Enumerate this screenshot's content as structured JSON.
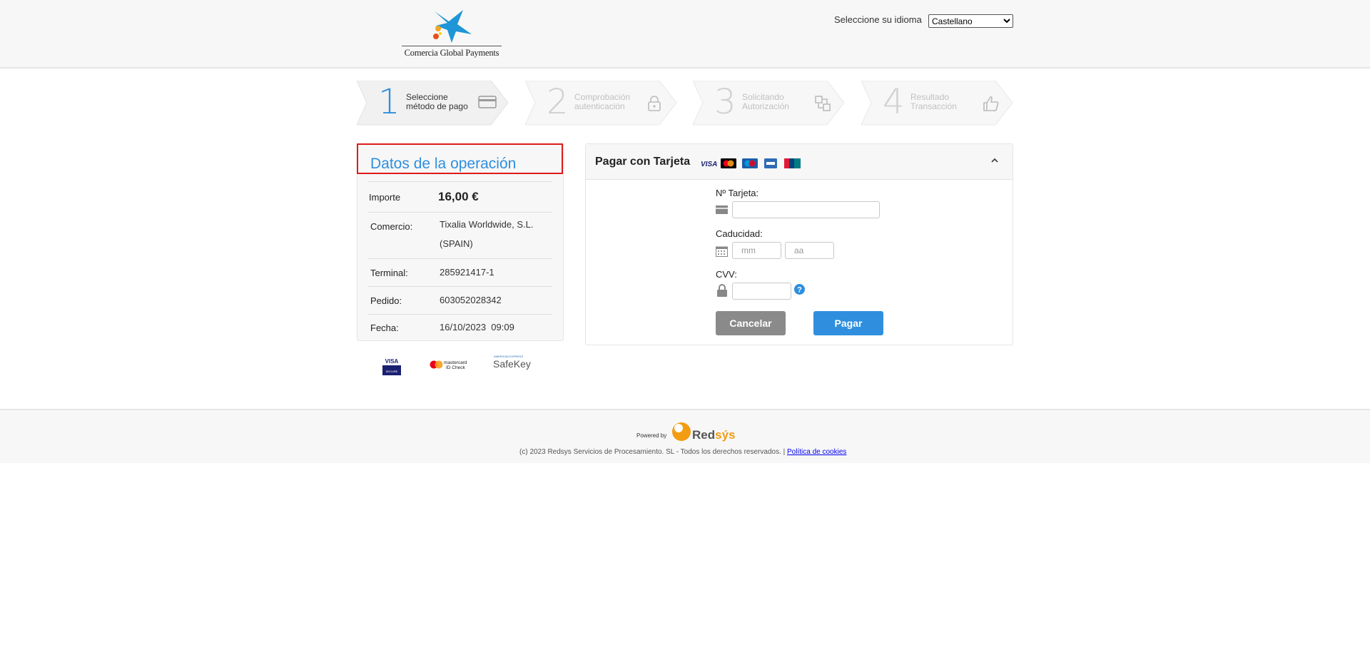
{
  "header": {
    "logo_text": "Comercia Global Payments",
    "language_label": "Seleccione su idioma",
    "language_selected": "Castellano"
  },
  "steps": [
    {
      "number": "1",
      "line1": "Seleccione",
      "line2": "método de pago",
      "icon": "card-icon",
      "active": true
    },
    {
      "number": "2",
      "line1": "Comprobación",
      "line2": "autenticación",
      "icon": "lock-icon",
      "active": false
    },
    {
      "number": "3",
      "line1": "Solicitando",
      "line2": "Autorización",
      "icon": "transfer-icon",
      "active": false
    },
    {
      "number": "4",
      "line1": "Resultado",
      "line2": "Transacción",
      "icon": "thumbs-up-icon",
      "active": false
    }
  ],
  "operation": {
    "title": "Datos de la operación",
    "amount_label": "Importe",
    "amount_value": "16,00 €",
    "merchant_label": "Comercio:",
    "merchant_line1": "Tixalia Worldwide, S.L.",
    "merchant_line2": "(SPAIN)",
    "terminal_label": "Terminal:",
    "terminal_value": "285921417-1",
    "order_label": "Pedido:",
    "order_value": "603052028342",
    "date_label": "Fecha:",
    "date_value": "16/10/2023  09:09",
    "badges": [
      "visa-secure-badge",
      "mastercard-id-check-badge",
      "amex-safekey-badge"
    ],
    "badge_texts": {
      "visa": "VISA",
      "visa_sub": "SECURE",
      "mc1": "mastercard",
      "mc2": "ID Check",
      "amex_top": "AMERICAN EXPRESS",
      "amex": "SafeKey"
    }
  },
  "payment": {
    "title": "Pagar con Tarjeta",
    "card_brands": [
      "visa",
      "mastercard",
      "maestro",
      "amex",
      "unionpay"
    ],
    "card_number_label": "Nº Tarjeta:",
    "card_number_value": "",
    "expiry_label": "Caducidad:",
    "month_placeholder": "mm",
    "year_placeholder": "aa",
    "cvv_label": "CVV:",
    "cvv_value": "",
    "cancel_label": "Cancelar",
    "pay_label": "Pagar"
  },
  "footer": {
    "powered_by": "Powered by",
    "brand_prefix": "Red",
    "brand_suffix": "sýs",
    "copyright": "(c) 2023 Redsys Servicios de Procesamiento. SL - Todos los derechos reservados. |",
    "cookie_link": "Política de cookies"
  },
  "colors": {
    "accent": "#2f8fde",
    "cancel": "#8a8a8a",
    "highlight_frame": "#e01a1a",
    "brand_orange": "#f39c12"
  }
}
